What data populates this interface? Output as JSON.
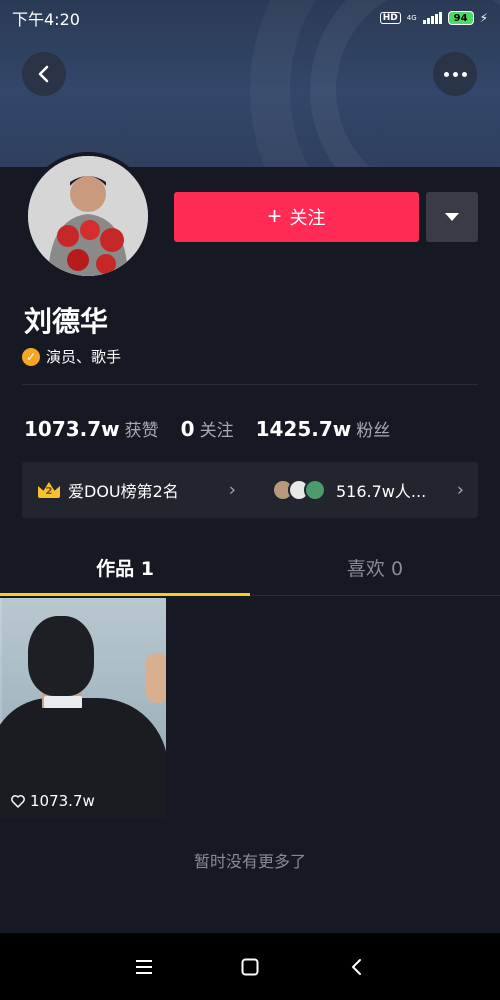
{
  "status_bar": {
    "time": "下午4:20",
    "hd": "HD",
    "network": "4G",
    "battery": "94"
  },
  "profile": {
    "name": "刘德华",
    "verified_text": "演员、歌手",
    "follow_label": "关注",
    "stats": [
      {
        "value": "1073.7w",
        "label": "获赞"
      },
      {
        "value": "0",
        "label": "关注"
      },
      {
        "value": "1425.7w",
        "label": "粉丝"
      }
    ]
  },
  "rank_card": {
    "rank_badge": "2",
    "rank_text": "爱DOU榜第2名",
    "watchers_text": "516.7w人..."
  },
  "tabs": [
    {
      "label": "作品 1",
      "active": true
    },
    {
      "label": "喜欢 0",
      "active": false
    }
  ],
  "videos": [
    {
      "likes": "1073.7w"
    }
  ],
  "empty_text": "暂时没有更多了",
  "colors": {
    "background": "#161823",
    "follow_button": "#fe2c55",
    "tab_indicator": "#face15",
    "verify_badge": "#f5a623"
  },
  "icons": [
    "back-arrow-icon",
    "more-icon",
    "plus-icon",
    "dropdown-arrow-icon",
    "verified-icon",
    "crown-icon",
    "chevron-right-icon",
    "heart-icon",
    "menu-icon",
    "home-square-icon",
    "back-nav-icon"
  ]
}
